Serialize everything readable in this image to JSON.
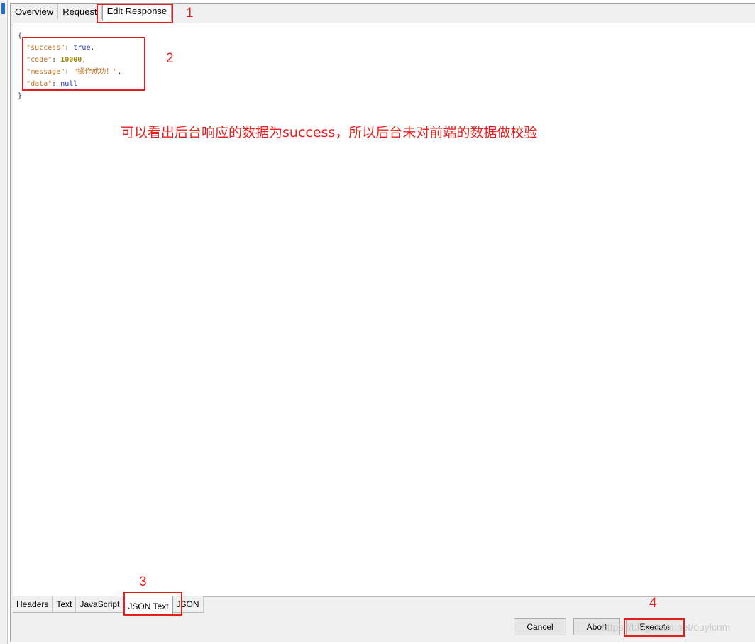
{
  "top_tabs": [
    "Overview",
    "Request",
    "Edit Response"
  ],
  "code": {
    "open": "{",
    "close": "}",
    "success_key": "\"success\"",
    "success_val": "true",
    "code_key": "\"code\"",
    "code_val": "10000",
    "message_key": "\"message\"",
    "message_val": "\"操作成功！\"",
    "data_key": "\"data\"",
    "data_val": "null"
  },
  "annotations": {
    "n1": "1",
    "n2": "2",
    "n3": "3",
    "n4": "4",
    "note": "可以看出后台响应的数据为success，所以后台未对前端的数据做校验"
  },
  "bottom_tabs": [
    "Headers",
    "Text",
    "JavaScript",
    "JSON Text",
    "JSON"
  ],
  "buttons": {
    "cancel": "Cancel",
    "abort": "Abort",
    "execute": "Execute"
  },
  "watermark": "https://blog.csdn.net/ouyicnm",
  "colors": {
    "annotation": "#e02020",
    "json_key": "#c07020",
    "json_literal": "#2030b0",
    "json_number": "#a08a00"
  }
}
